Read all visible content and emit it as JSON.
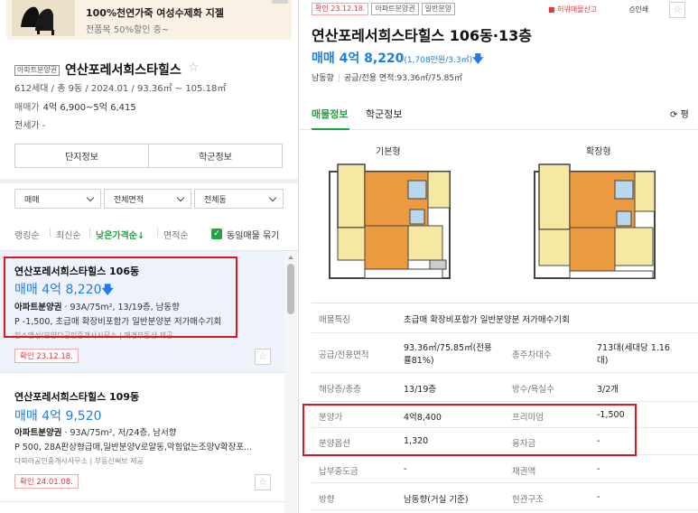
{
  "ad": {
    "title": "100%천연가죽 여성수제화 지젤",
    "subtitle": "전품목 50%할인 중~"
  },
  "complex": {
    "tag": "아파트분양권",
    "name": "연산포레서희스타힐스",
    "info": "612세대 / 총 9동 / 2024.01 / 93.36㎡ ~ 105.18㎡",
    "price_label": "매매가",
    "price_value": "4억 6,900~5억 6,415",
    "rent_label": "전세가",
    "rent_value": "-",
    "tabs": [
      "단지정보",
      "학군정보"
    ]
  },
  "filters": [
    "매매",
    "전체면적",
    "전체동"
  ],
  "sorts": [
    "랭킹순",
    "최신순",
    "낮은가격순↓",
    "면적순"
  ],
  "same_listing_label": "동일매물 묶기",
  "listings": [
    {
      "title": "연산포레서희스타힐스 106동",
      "price": "매매 4억 8,220",
      "type": "아파트분양권",
      "details": " · 93A/75m², 13/19층, 남동향",
      "desc": "P -1,500, 초급매 확장비포함가 일반분양분 저가매수기회",
      "agent": "힐스명성(분양다공인중개사사무소 | 매경부동산 제공",
      "confirm": "확인 23.12.18."
    },
    {
      "title": "연산포레서희스타힐스 109동",
      "price": "매매 4억 9,520",
      "type": "아파트분양권",
      "details": " · 93A/75m², 저/24층, 남서향",
      "desc": "P 500, 28A판상형급매,일반분양V로얄동,막힘없는조망V확장포...",
      "agent": "다파라공인중개사사무소 | 부동산써브 제공",
      "confirm": "확인 24.01.08."
    }
  ],
  "detail": {
    "tags": [
      "확인 23.12.18.",
      "아파트분양권",
      "일반분양"
    ],
    "report": "허위매물신고",
    "print": "인쇄",
    "title": "연산포레서희스타힐스 106동·13층",
    "price": "매매 4억 8,220",
    "price_sub": "(1,708만원/3.3㎡)",
    "direction": "남동향",
    "area": "공급/전용 면적:93.36㎡/75.85㎡",
    "tabs": [
      "매물정보",
      "학군정보"
    ],
    "refresh_label": "평",
    "floorplans": [
      "기본형",
      "확장형"
    ],
    "rows": [
      {
        "l1": "매물특징",
        "v1": "초급매 확장비포함가 일반분양분 저가매수기회"
      },
      {
        "l1": "공급/전용면적",
        "v1a": "93.36㎡/75.85㎡(전용",
        "v1b": "률81%)",
        "l2": "총주차대수",
        "v2a": "713대(세대당 1.16",
        "v2b": "대)"
      },
      {
        "l1": "해당층/총층",
        "v1": "13/19층",
        "l2": "방수/욕실수",
        "v2": "3/2개"
      },
      {
        "l1": "분양가",
        "v1": "4억8,400",
        "l2": "프리미엄",
        "v2": "-1,500"
      },
      {
        "l1": "분양옵션",
        "v1": "1,320",
        "l2": "융자금",
        "v2": "-"
      },
      {
        "l1": "납부중도금",
        "v1": "-",
        "l2": "채권액",
        "v2": "-"
      },
      {
        "l1": "방향",
        "v1": "남동향(거실 기준)",
        "l2": "현관구조",
        "v2": "-"
      }
    ]
  },
  "colors": {
    "green": "#1ea341",
    "blue": "#1d7ee8",
    "red": "#e0161e"
  }
}
